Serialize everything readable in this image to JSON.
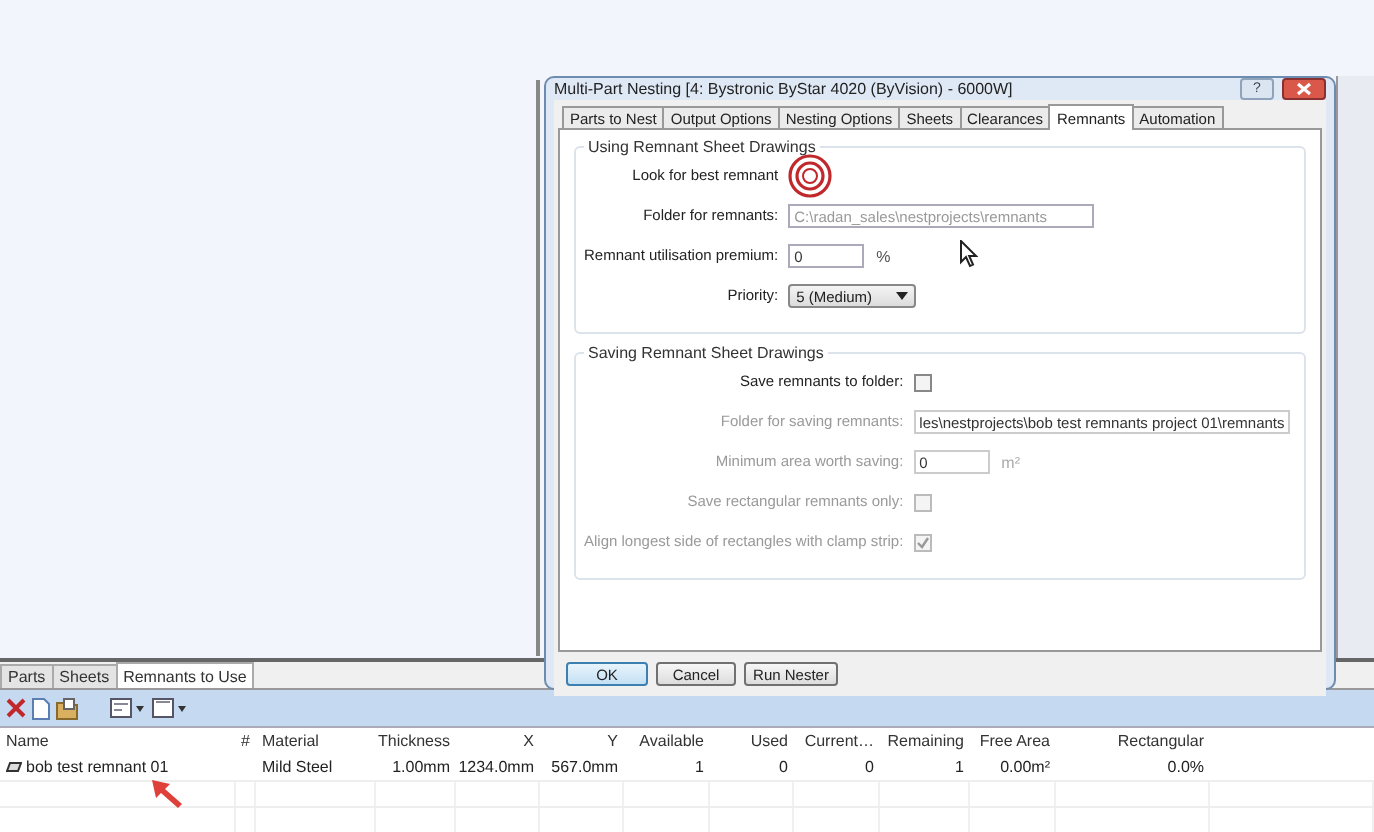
{
  "dialog": {
    "title": "Multi-Part Nesting [4: Bystronic ByStar 4020 (ByVision) - 6000W]",
    "help_label": "?",
    "tabs": [
      {
        "label": "Parts to Nest",
        "selected": false
      },
      {
        "label": "Output Options",
        "selected": false
      },
      {
        "label": "Nesting Options",
        "selected": false
      },
      {
        "label": "Sheets",
        "selected": false
      },
      {
        "label": "Clearances",
        "selected": false
      },
      {
        "label": "Remnants",
        "selected": true
      },
      {
        "label": "Automation",
        "selected": false
      }
    ],
    "groups": [
      {
        "title": "Using Remnant Sheet Drawings",
        "rows": [
          {
            "kind": "marker",
            "label": "Look for best remnant",
            "disabled": false
          },
          {
            "kind": "path",
            "label": "Folder for remnants:",
            "value": "C:\\radan_sales\\nestprojects\\remnants",
            "value_dimmed": true,
            "disabled": false
          },
          {
            "kind": "number",
            "label": "Remnant utilisation premium:",
            "value": "0",
            "unit": "%",
            "disabled": false
          },
          {
            "kind": "select",
            "label": "Priority:",
            "value": "5 (Medium)",
            "disabled": false
          }
        ]
      },
      {
        "title": "Saving Remnant Sheet Drawings",
        "rows": [
          {
            "kind": "checkbox",
            "label": "Save remnants to folder:",
            "checked": false,
            "disabled": false
          },
          {
            "kind": "path",
            "label": "Folder for saving remnants:",
            "value": "les\\nestprojects\\bob test remnants project 01\\remnants",
            "value_dimmed": false,
            "disabled": true
          },
          {
            "kind": "number",
            "label": "Minimum area worth saving:",
            "value": "0",
            "unit": "m²",
            "disabled": true
          },
          {
            "kind": "checkbox",
            "label": "Save rectangular remnants only:",
            "checked": false,
            "disabled": true
          },
          {
            "kind": "checkbox",
            "label": "Align longest side of rectangles with clamp strip:",
            "checked": true,
            "disabled": true
          }
        ]
      }
    ],
    "buttons": [
      {
        "label": "OK",
        "default": true
      },
      {
        "label": "Cancel",
        "default": false
      },
      {
        "label": "Run Nester",
        "default": false
      }
    ]
  },
  "panel": {
    "tabs": [
      {
        "label": "Parts",
        "selected": false
      },
      {
        "label": "Sheets",
        "selected": false
      },
      {
        "label": "Remnants to Use",
        "selected": true
      }
    ],
    "table": {
      "columns": [
        "Name",
        "#",
        "Material",
        "Thickness",
        "X",
        "Y",
        "Available",
        "Used",
        "Current…",
        "Remaining",
        "Free Area",
        "Rectangular"
      ],
      "rows": [
        {
          "name": "bob test remnant 01",
          "material": "Mild Steel",
          "thickness": "1.00mm",
          "x": "1234.0mm",
          "y": "567.0mm",
          "available": "1",
          "used": "0",
          "current": "0",
          "remaining": "1",
          "free_area": "0.00m²",
          "rectangular": "0.0%"
        }
      ]
    }
  }
}
